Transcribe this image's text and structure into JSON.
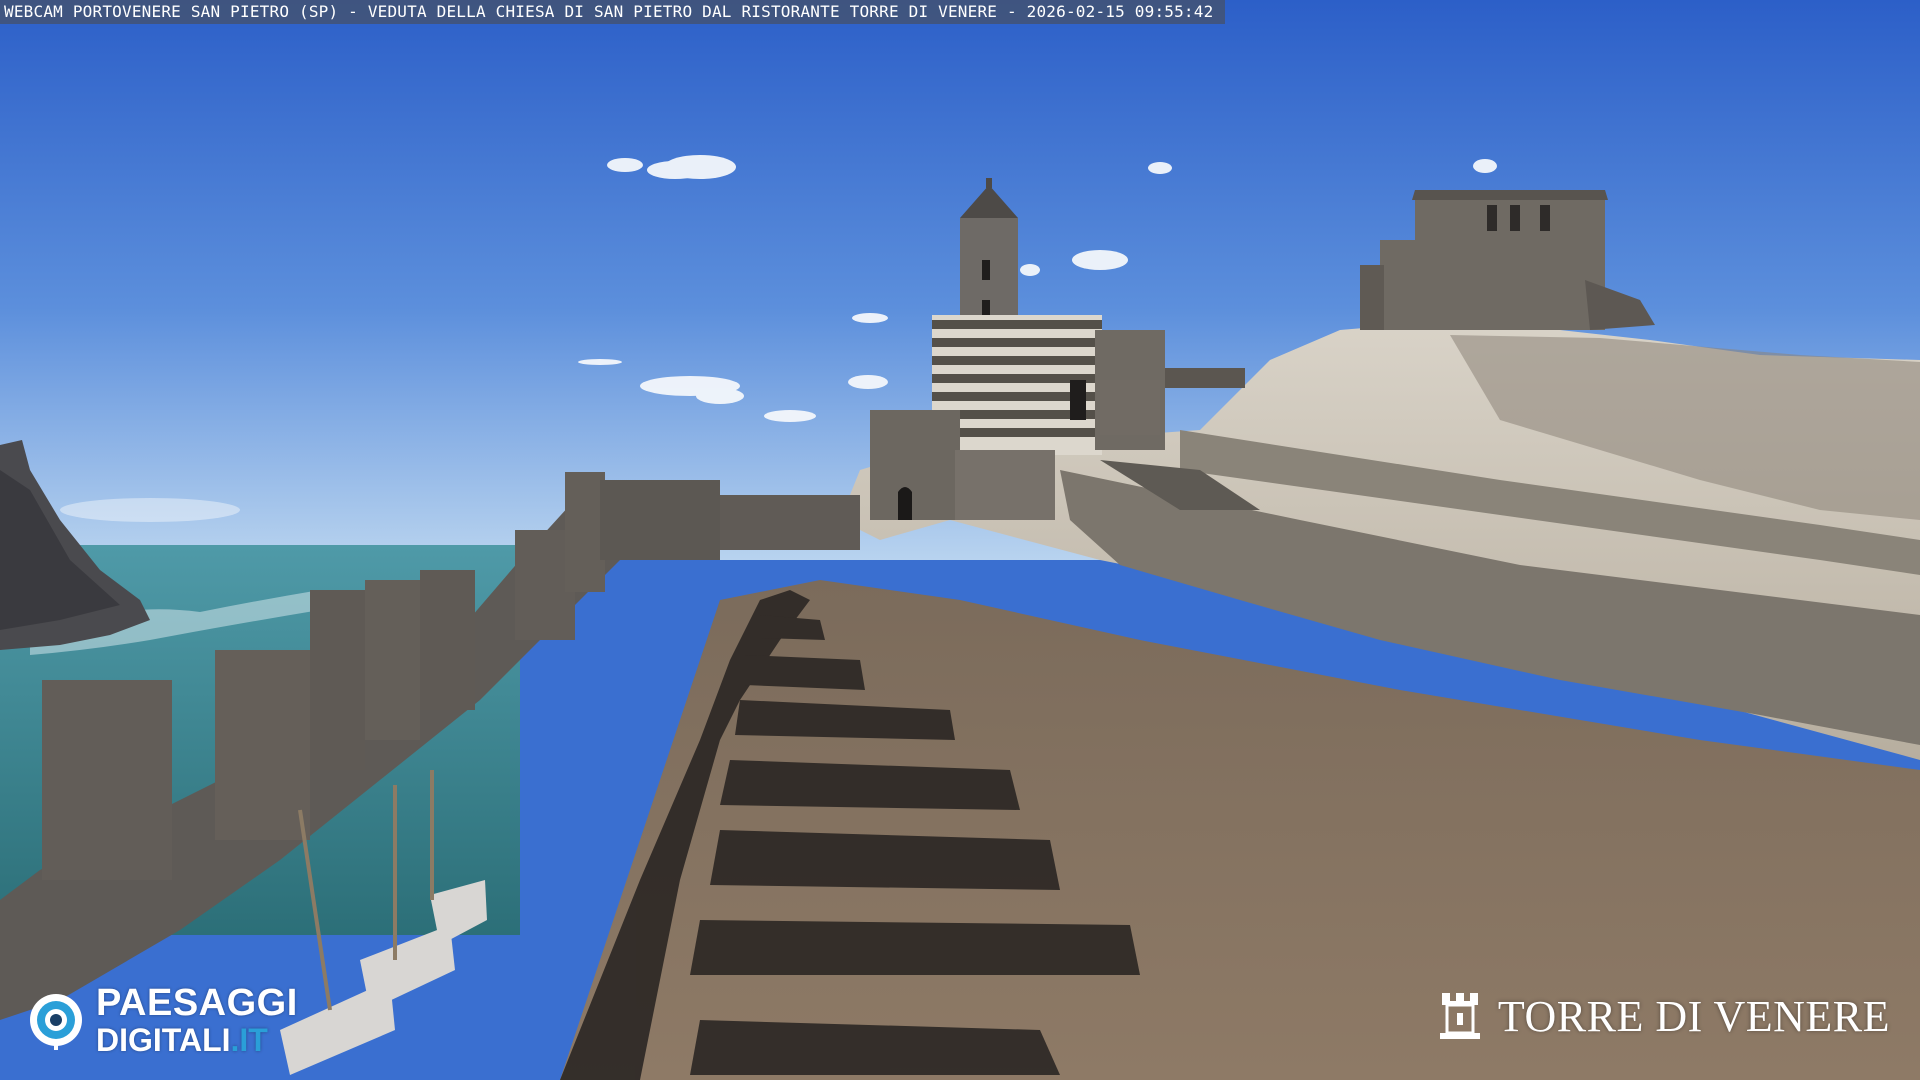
{
  "caption": {
    "text": "WEBCAM PORTOVENERE SAN PIETRO (SP) - VEDUTA DELLA CHIESA DI SAN PIETRO DAL RISTORANTE TORRE DI VENERE - 2026-02-15 09:55:42"
  },
  "logo_left": {
    "icon": "eye-icon",
    "line1": "PAESAGGI",
    "line2": "DIGITALI",
    "line2_suffix": ".IT",
    "accent": "#2a9fd8"
  },
  "logo_right": {
    "icon": "tower-icon",
    "name": "TORRE DI VENERE"
  },
  "colors": {
    "sky_top": "#2f63c9",
    "sky_bottom": "#a8c8ec",
    "sea": "#3f8a96",
    "stone": "#6d675e",
    "path": "#8a7864",
    "shadow": "#2b2623"
  }
}
